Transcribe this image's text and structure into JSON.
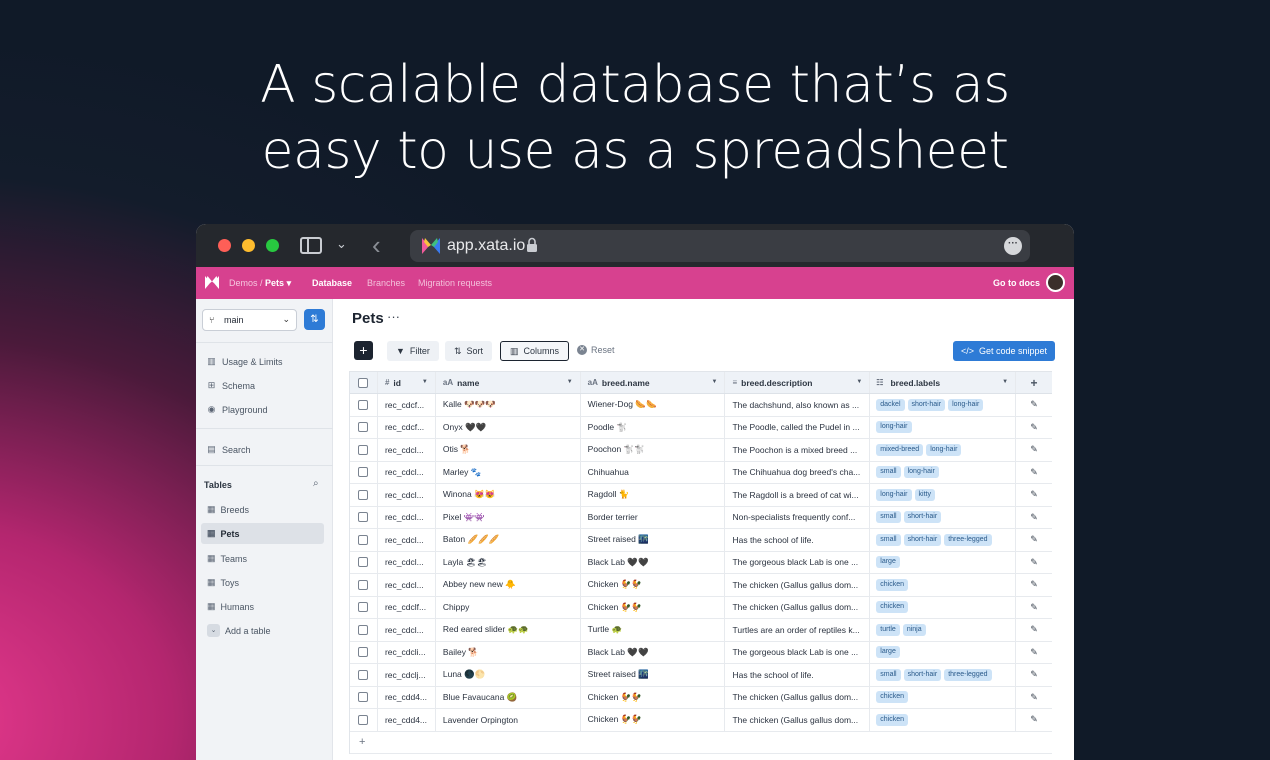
{
  "headline": {
    "line1": "A scalable database that’s as",
    "line2": "easy to use as a spreadsheet"
  },
  "browser": {
    "url": "app.xata.io",
    "back_icon": "chevron-left-icon",
    "more_icon": "ellipsis-icon"
  },
  "appbar": {
    "workspace": "Demos",
    "database": "Pets",
    "nav": [
      "Database",
      "Branches",
      "Migration requests"
    ],
    "docs_label": "Go to docs",
    "bg_color": "#d7418f"
  },
  "sidebar": {
    "branch": "main",
    "items": [
      {
        "label": "Usage & Limits",
        "icon": "chart-icon"
      },
      {
        "label": "Schema",
        "icon": "hierarchy-icon"
      },
      {
        "label": "Playground",
        "icon": "globe-icon"
      }
    ],
    "search_label": "Search",
    "tables_heading": "Tables",
    "tables": [
      "Breeds",
      "Pets",
      "Teams",
      "Toys",
      "Humans"
    ],
    "active_table": "Pets",
    "add_table_label": "Add a table"
  },
  "main": {
    "title": "Pets",
    "toolbar": {
      "filter": "Filter",
      "sort": "Sort",
      "columns": "Columns",
      "reset": "Reset",
      "code_snippet": "Get code snippet"
    },
    "columns": [
      {
        "label": "id",
        "icon": "#"
      },
      {
        "label": "name",
        "icon": "aA"
      },
      {
        "label": "breed.name",
        "icon": "aA"
      },
      {
        "label": "breed.description",
        "icon": "≡"
      },
      {
        "label": "breed.labels",
        "icon": "☷"
      }
    ],
    "rows": [
      {
        "id": "rec_cdcf...",
        "name": "Kalle 🐶🐶🐶",
        "breed": "Wiener-Dog 🌭🌭",
        "desc": "The dachshund, also known as ...",
        "labels": [
          "dackel",
          "short-hair",
          "long-hair"
        ]
      },
      {
        "id": "rec_cdcf...",
        "name": "Onyx 🖤🖤",
        "breed": "Poodle 🐩",
        "desc": "The Poodle, called the Pudel in ...",
        "labels": [
          "long-hair"
        ]
      },
      {
        "id": "rec_cdcl...",
        "name": "Otis 🐕",
        "breed": "Poochon 🐩🐩",
        "desc": "The Poochon is a mixed breed ...",
        "labels": [
          "mixed-breed",
          "long-hair"
        ]
      },
      {
        "id": "rec_cdcl...",
        "name": "Marley 🐾",
        "breed": "Chihuahua",
        "desc": "The Chihuahua dog breed's cha...",
        "labels": [
          "small",
          "long-hair"
        ]
      },
      {
        "id": "rec_cdcl...",
        "name": "Winona 😻😻",
        "breed": "Ragdoll 🐈",
        "desc": "The Ragdoll is a breed of cat wi...",
        "labels": [
          "long-hair",
          "kitty"
        ]
      },
      {
        "id": "rec_cdcl...",
        "name": "Pixel 👾👾",
        "breed": "Border terrier",
        "desc": "Non-specialists frequently conf...",
        "labels": [
          "small",
          "short-hair"
        ]
      },
      {
        "id": "rec_cdcl...",
        "name": "Baton 🥖🥖🥖",
        "breed": "Street raised 🌃",
        "desc": "Has the school of life.",
        "labels": [
          "small",
          "short-hair",
          "three-legged"
        ]
      },
      {
        "id": "rec_cdcl...",
        "name": "Layla 🏖🏖",
        "breed": "Black Lab 🖤🖤",
        "desc": "The gorgeous black Lab is one ...",
        "labels": [
          "large"
        ]
      },
      {
        "id": "rec_cdcl...",
        "name": "Abbey new new 🐥",
        "breed": "Chicken 🐓🐓",
        "desc": "The chicken (Gallus gallus dom...",
        "labels": [
          "chicken"
        ]
      },
      {
        "id": "rec_cdclf...",
        "name": "Chippy",
        "breed": "Chicken 🐓🐓",
        "desc": "The chicken (Gallus gallus dom...",
        "labels": [
          "chicken"
        ]
      },
      {
        "id": "rec_cdcl...",
        "name": "Red eared slider 🐢🐢",
        "breed": "Turtle 🐢",
        "desc": "Turtles are an order of reptiles k...",
        "labels": [
          "turtle",
          "ninja"
        ]
      },
      {
        "id": "rec_cdcli...",
        "name": "Bailey 🐕",
        "breed": "Black Lab 🖤🖤",
        "desc": "The gorgeous black Lab is one ...",
        "labels": [
          "large"
        ]
      },
      {
        "id": "rec_cdclj...",
        "name": "Luna 🌑🌕",
        "breed": "Street raised 🌃",
        "desc": "Has the school of life.",
        "labels": [
          "small",
          "short-hair",
          "three-legged"
        ]
      },
      {
        "id": "rec_cdd4...",
        "name": "Blue Favaucana 🥝",
        "breed": "Chicken 🐓🐓",
        "desc": "The chicken (Gallus gallus dom...",
        "labels": [
          "chicken"
        ]
      },
      {
        "id": "rec_cdd4...",
        "name": "Lavender Orpington",
        "breed": "Chicken 🐓🐓",
        "desc": "The chicken (Gallus gallus dom...",
        "labels": [
          "chicken"
        ]
      }
    ]
  }
}
